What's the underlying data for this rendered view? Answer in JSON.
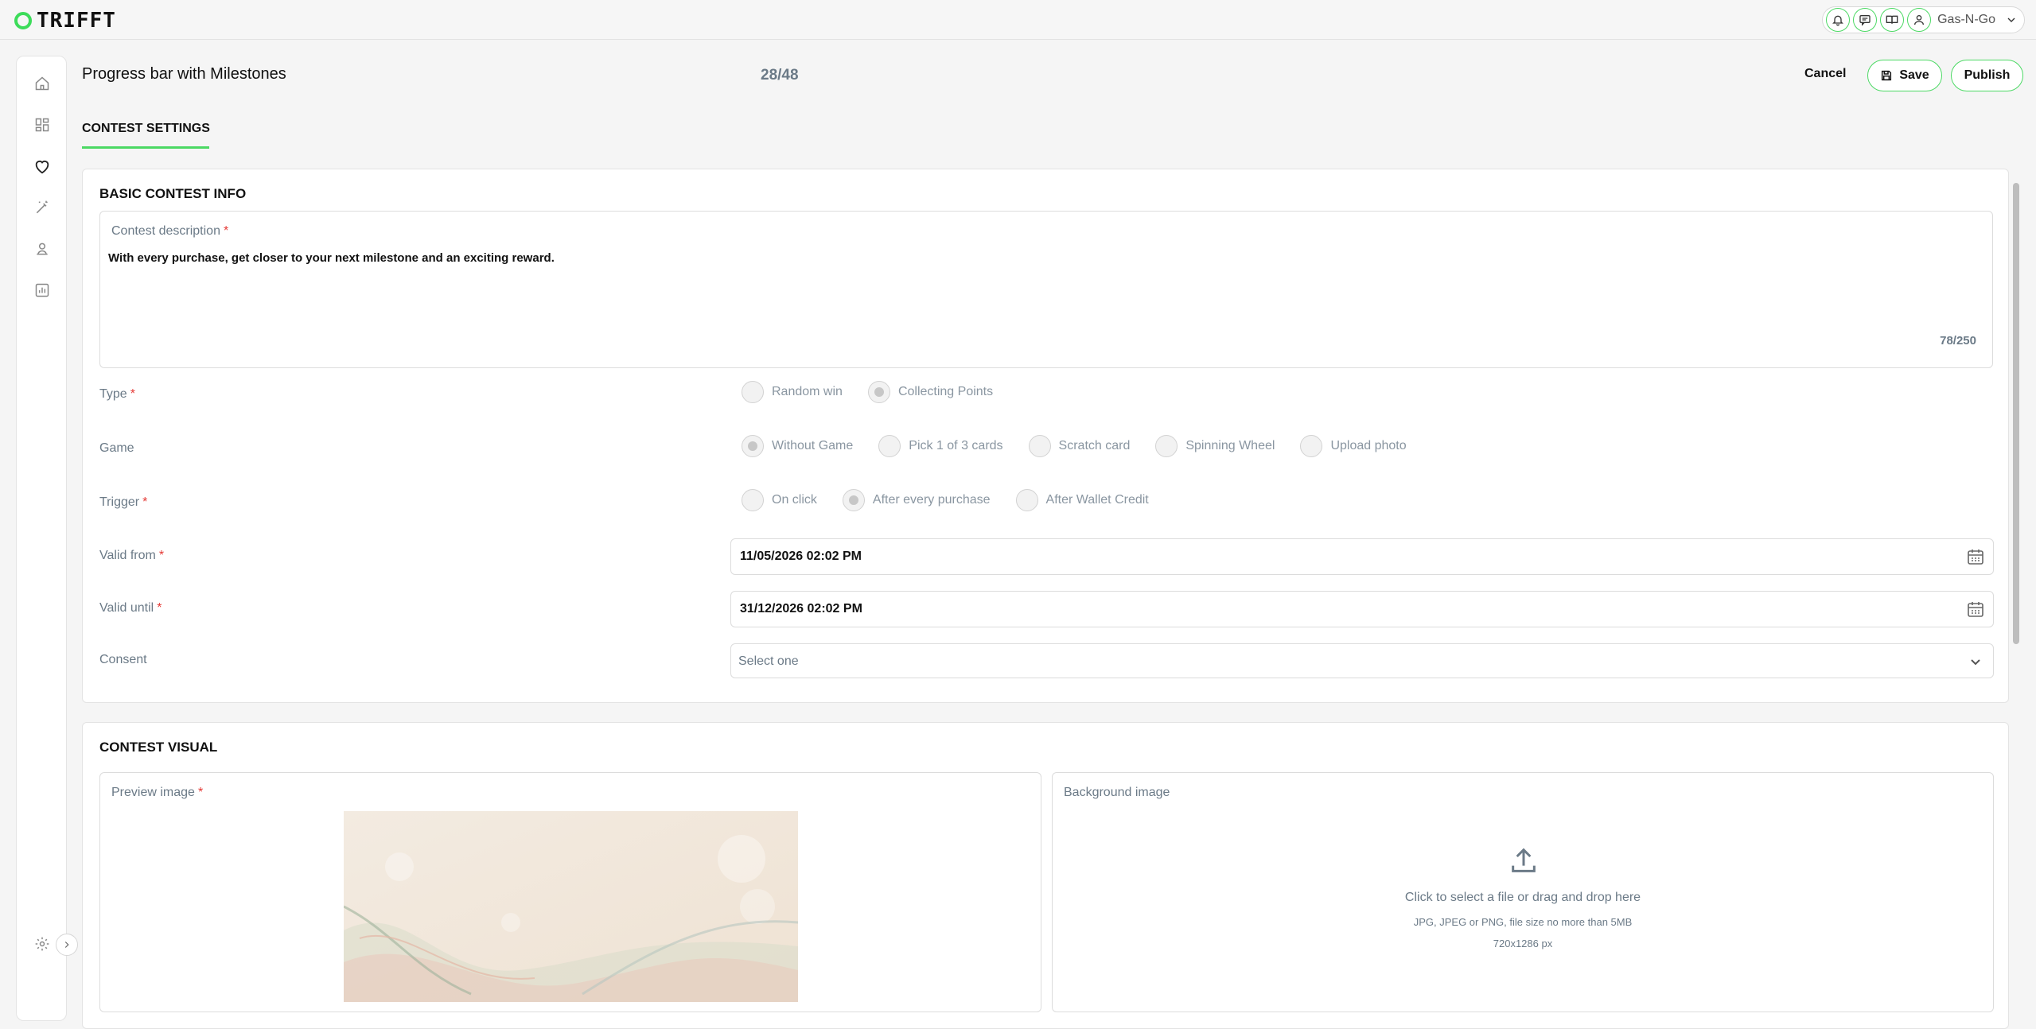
{
  "app": {
    "logo_text": "TRIFFT",
    "accent_color": "#4cd964"
  },
  "topbar": {
    "icons": [
      "bell-icon",
      "chat-icon",
      "book-icon",
      "user-icon"
    ],
    "account_name": "Gas-N-Go"
  },
  "sidebar": {
    "items": [
      "home-icon",
      "dashboard-icon",
      "heart-icon",
      "magic-wand-icon",
      "person-icon",
      "chart-icon"
    ],
    "bottom": [
      "settings-icon",
      "chevron-right-icon"
    ]
  },
  "header": {
    "title": "Progress bar with Milestones",
    "counter": "28/48",
    "cancel_label": "Cancel",
    "save_label": "Save",
    "publish_label": "Publish"
  },
  "tabs": [
    {
      "label": "CONTEST SETTINGS",
      "active": true
    }
  ],
  "basic_info": {
    "title": "BASIC CONTEST INFO",
    "description": {
      "label": "Contest description",
      "required_mark": "*",
      "value": "With every purchase, get closer to your next milestone and an exciting reward.",
      "count": "78/250"
    },
    "type": {
      "label": "Type",
      "options": [
        {
          "label": "Random win",
          "selected": false
        },
        {
          "label": "Collecting Points",
          "selected": true
        }
      ]
    },
    "game": {
      "label": "Game",
      "options": [
        {
          "label": "Without Game",
          "selected": true
        },
        {
          "label": "Pick 1 of 3 cards",
          "selected": false
        },
        {
          "label": "Scratch card",
          "selected": false
        },
        {
          "label": "Spinning Wheel",
          "selected": false
        },
        {
          "label": "Upload photo",
          "selected": false
        }
      ]
    },
    "trigger": {
      "label": "Trigger",
      "options": [
        {
          "label": "On click",
          "selected": false
        },
        {
          "label": "After every purchase",
          "selected": true
        },
        {
          "label": "After Wallet Credit",
          "selected": false
        }
      ]
    },
    "valid_from": {
      "label": "Valid from",
      "value": "11/05/2026 02:02 PM"
    },
    "valid_until": {
      "label": "Valid until",
      "value": "31/12/2026 02:02 PM"
    },
    "consent": {
      "label": "Consent",
      "placeholder": "Select one"
    }
  },
  "visual": {
    "title": "CONTEST VISUAL",
    "preview": {
      "label": "Preview image"
    },
    "background": {
      "label": "Background image",
      "upload_text": "Click to select a file or drag and drop here",
      "upload_hint": "JPG, JPEG or PNG, file size no more than 5MB",
      "upload_size": "720x1286 px"
    }
  }
}
